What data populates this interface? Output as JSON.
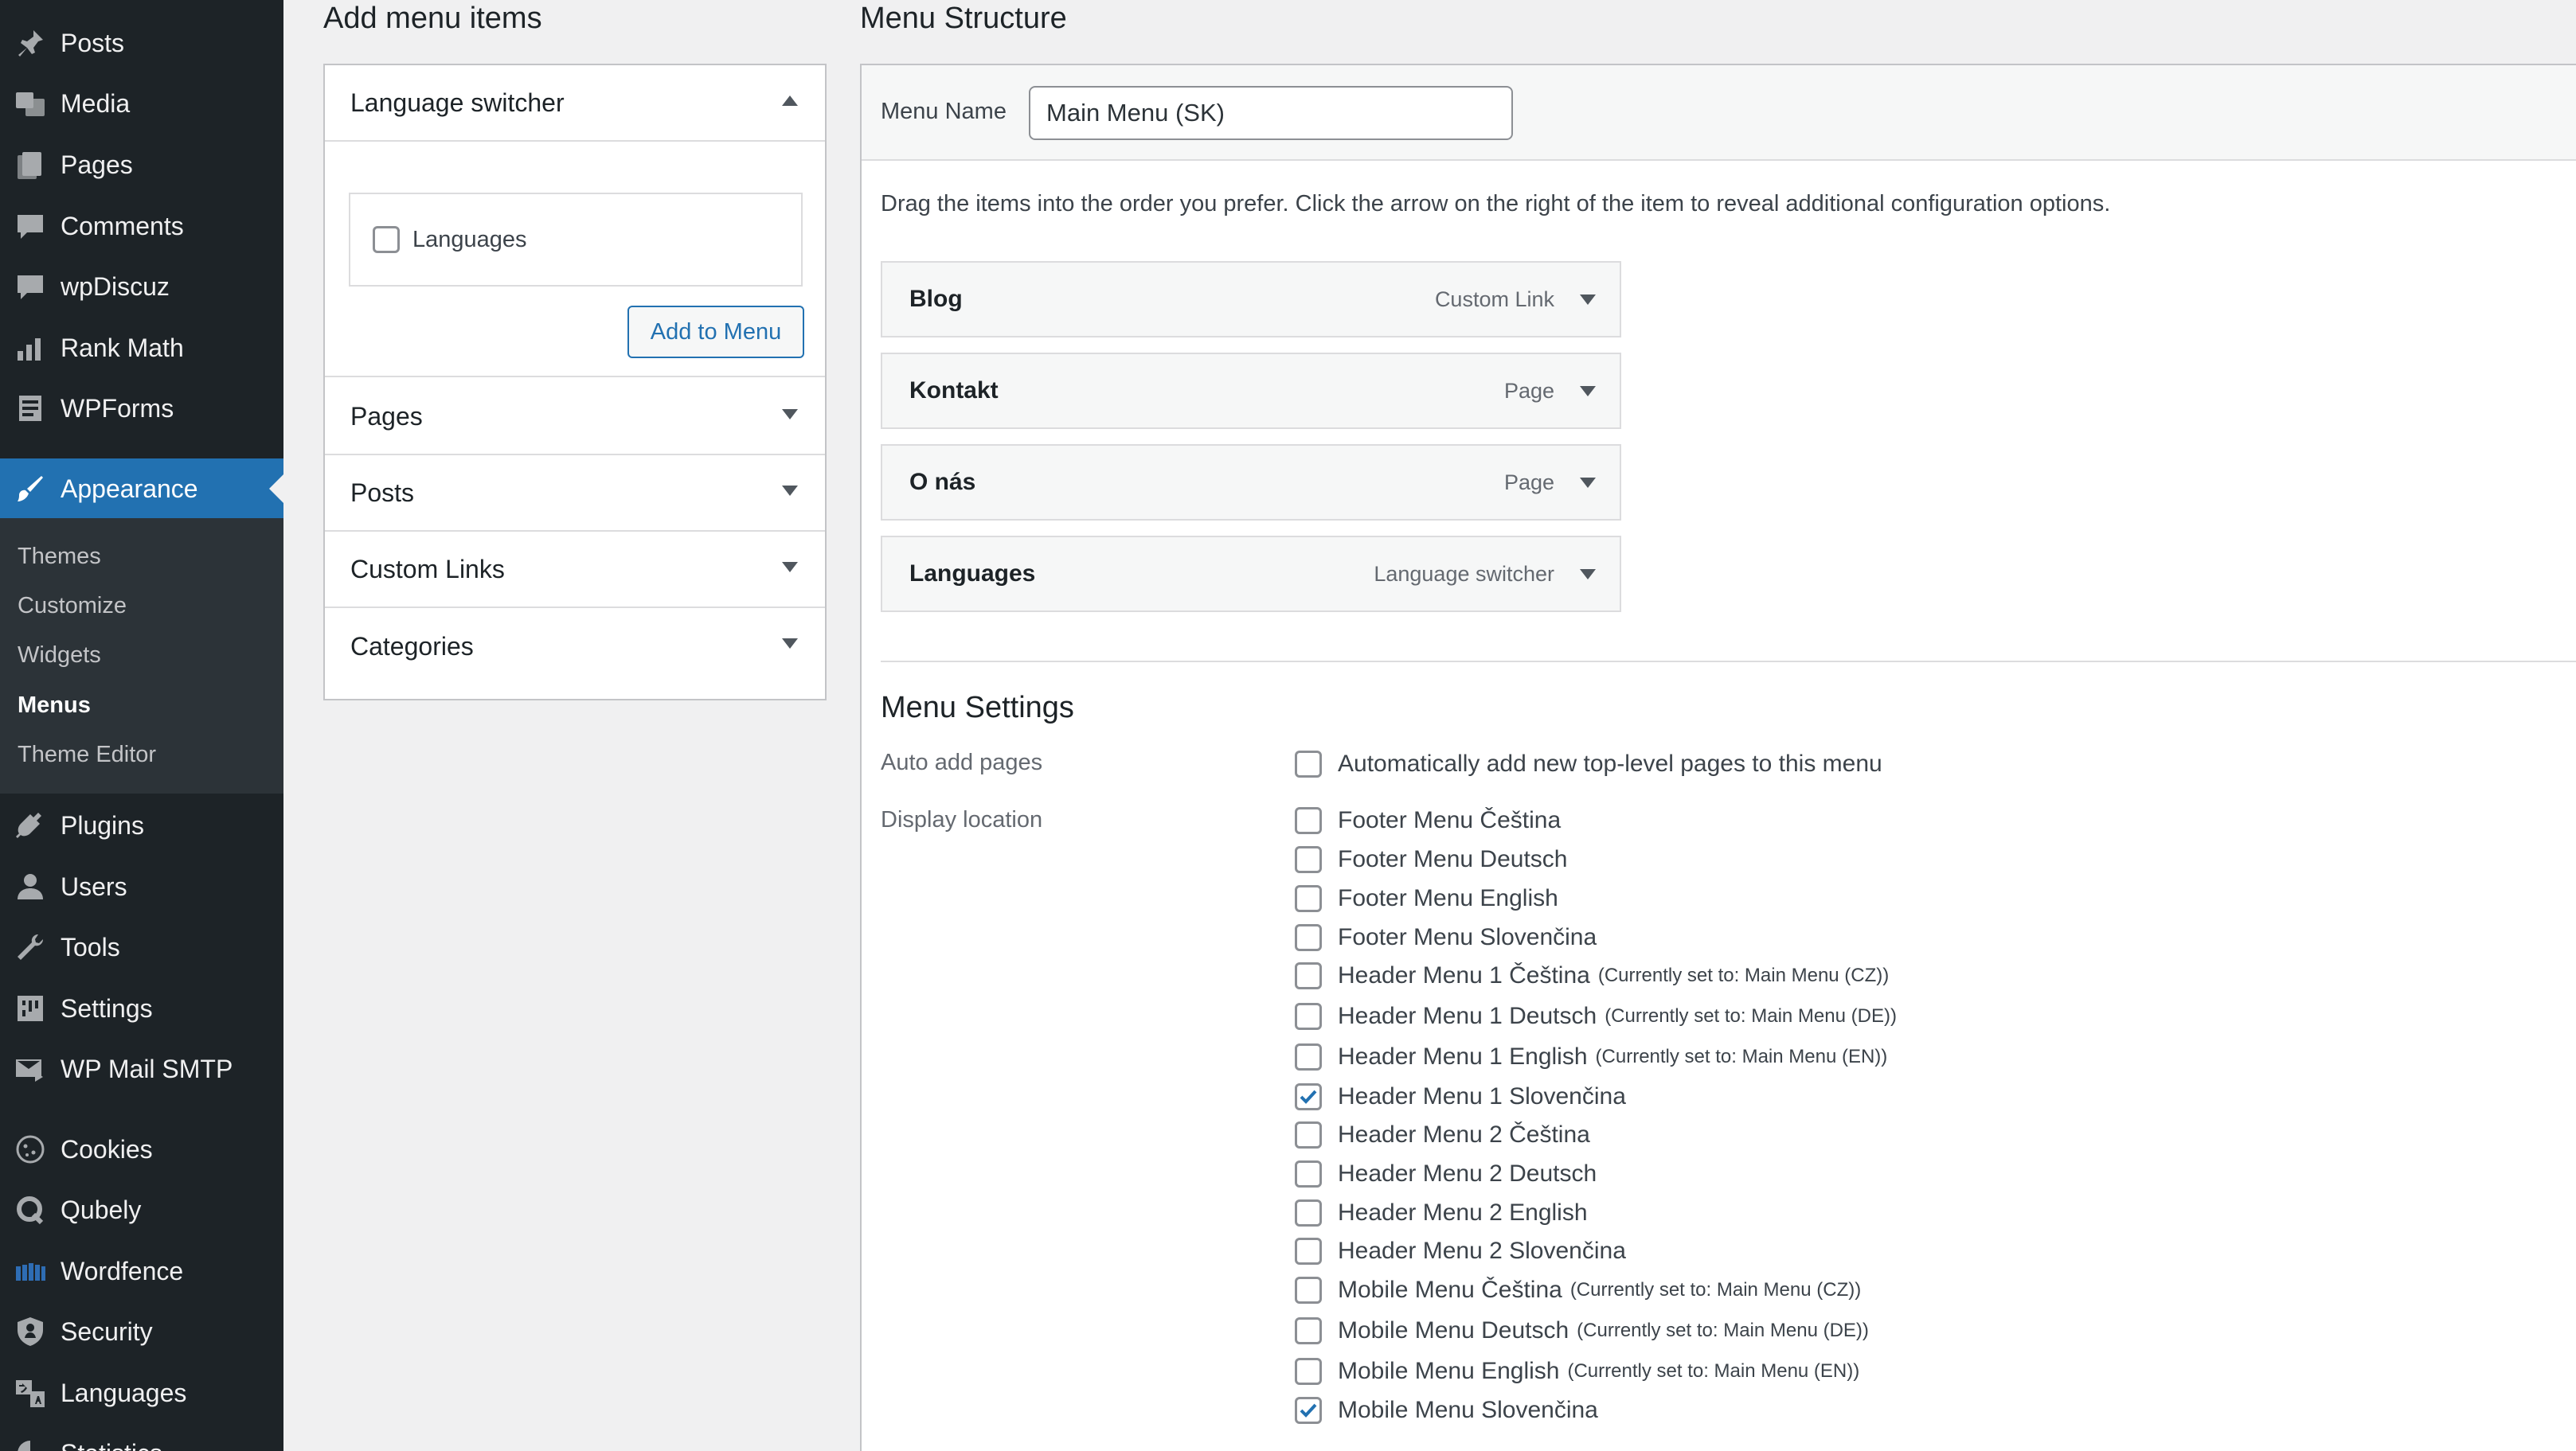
{
  "sidebar": {
    "items": [
      {
        "label": "Posts",
        "icon": "pushpin-icon"
      },
      {
        "label": "Media",
        "icon": "media-icon"
      },
      {
        "label": "Pages",
        "icon": "pages-icon"
      },
      {
        "label": "Comments",
        "icon": "comment-icon"
      },
      {
        "label": "wpDiscuz",
        "icon": "comment-icon"
      },
      {
        "label": "Rank Math",
        "icon": "chart-icon"
      },
      {
        "label": "WPForms",
        "icon": "form-icon"
      },
      {
        "label": "Appearance",
        "icon": "paintbrush-icon"
      },
      {
        "label": "Plugins",
        "icon": "plugin-icon"
      },
      {
        "label": "Users",
        "icon": "user-icon"
      },
      {
        "label": "Tools",
        "icon": "wrench-icon"
      },
      {
        "label": "Settings",
        "icon": "settings-icon"
      },
      {
        "label": "WP Mail SMTP",
        "icon": "mail-icon"
      },
      {
        "label": "Cookies",
        "icon": "cookie-icon"
      },
      {
        "label": "Qubely",
        "icon": "qubely-icon"
      },
      {
        "label": "Wordfence",
        "icon": "wordfence-icon"
      },
      {
        "label": "Security",
        "icon": "shield-icon"
      },
      {
        "label": "Languages",
        "icon": "translate-icon"
      },
      {
        "label": "Statistics",
        "icon": "stats-icon"
      }
    ],
    "submenu": [
      "Themes",
      "Customize",
      "Widgets",
      "Menus",
      "Theme Editor"
    ],
    "active_color": "#2271b1"
  },
  "add_items": {
    "title": "Add menu items",
    "sections": [
      "Language switcher",
      "Pages",
      "Posts",
      "Custom Links",
      "Categories"
    ],
    "lang_checkbox_label": "Languages",
    "add_button": "Add to Menu"
  },
  "structure": {
    "title": "Menu Structure",
    "name_label": "Menu Name",
    "name_value": "Main Menu (SK)",
    "instructions": "Drag the items into the order you prefer. Click the arrow on the right of the item to reveal additional configuration options.",
    "items": [
      {
        "title": "Blog",
        "type": "Custom Link"
      },
      {
        "title": "Kontakt",
        "type": "Page"
      },
      {
        "title": "O nás",
        "type": "Page"
      },
      {
        "title": "Languages",
        "type": "Language switcher"
      }
    ]
  },
  "settings": {
    "title": "Menu Settings",
    "auto_add_label": "Auto add pages",
    "auto_add_text": "Automatically add new top-level pages to this menu",
    "display_label": "Display location",
    "locations": [
      {
        "label": "Footer Menu Čeština",
        "note": "",
        "checked": false
      },
      {
        "label": "Footer Menu Deutsch",
        "note": "",
        "checked": false
      },
      {
        "label": "Footer Menu English",
        "note": "",
        "checked": false
      },
      {
        "label": "Footer Menu Slovenčina",
        "note": "",
        "checked": false
      },
      {
        "label": "Header Menu 1 Čeština",
        "note": "(Currently set to: Main Menu (CZ))",
        "checked": false
      },
      {
        "label": "Header Menu 1 Deutsch",
        "note": "(Currently set to: Main Menu (DE))",
        "checked": false
      },
      {
        "label": "Header Menu 1 English",
        "note": "(Currently set to: Main Menu (EN))",
        "checked": false
      },
      {
        "label": "Header Menu 1 Slovenčina",
        "note": "",
        "checked": true
      },
      {
        "label": "Header Menu 2 Čeština",
        "note": "",
        "checked": false
      },
      {
        "label": "Header Menu 2 Deutsch",
        "note": "",
        "checked": false
      },
      {
        "label": "Header Menu 2 English",
        "note": "",
        "checked": false
      },
      {
        "label": "Header Menu 2 Slovenčina",
        "note": "",
        "checked": false
      },
      {
        "label": "Mobile Menu Čeština",
        "note": "(Currently set to: Main Menu (CZ))",
        "checked": false
      },
      {
        "label": "Mobile Menu Deutsch",
        "note": "(Currently set to: Main Menu (DE))",
        "checked": false
      },
      {
        "label": "Mobile Menu English",
        "note": "(Currently set to: Main Menu (EN))",
        "checked": false
      },
      {
        "label": "Mobile Menu Slovenčina",
        "note": "",
        "checked": true
      }
    ]
  }
}
